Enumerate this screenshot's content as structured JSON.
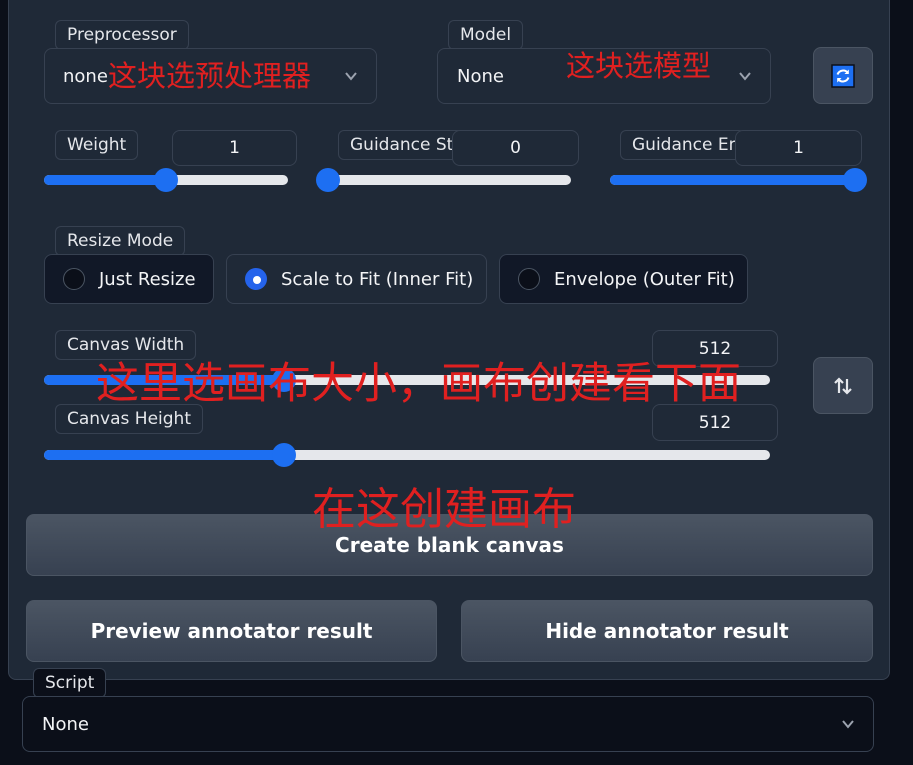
{
  "controlnet": {
    "preprocessor": {
      "label": "Preprocessor",
      "value": "none"
    },
    "model": {
      "label": "Model",
      "value": "None"
    },
    "weight": {
      "label": "Weight",
      "value": "1",
      "level": 0.5
    },
    "guidance_start": {
      "label": "Guidance Start (T)",
      "value": "0",
      "level": 0.0
    },
    "guidance_end": {
      "label": "Guidance End (T)",
      "value": "1",
      "level": 1.0
    },
    "resize_mode": {
      "label": "Resize Mode",
      "options": [
        "Just Resize",
        "Scale to Fit (Inner Fit)",
        "Envelope (Outer Fit)"
      ],
      "selected": "Scale to Fit (Inner Fit)"
    },
    "canvas_width": {
      "label": "Canvas Width",
      "value": "512",
      "level": 0.33
    },
    "canvas_height": {
      "label": "Canvas Height",
      "value": "512",
      "level": 0.33
    },
    "create_canvas_label": "Create blank canvas",
    "preview_label": "Preview annotator result",
    "hide_label": "Hide annotator result"
  },
  "script": {
    "label": "Script",
    "value": "None"
  },
  "annotations": {
    "preprocessor_note": "这块选预处理器",
    "model_note": "这块选模型",
    "canvas_size_note": "这里选画布大小，画布创建看下面",
    "create_note": "在这创建画布"
  },
  "icons": {
    "refresh": "refresh-icon",
    "swap": "swap-vertical-icon",
    "chevron": "chevron-down-icon"
  },
  "colors": {
    "accent": "#1d6ff2",
    "annotation": "#e02020",
    "panel": "#1f2937",
    "background": "#0b0f19"
  }
}
